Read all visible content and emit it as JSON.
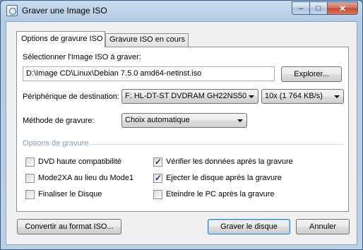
{
  "window": {
    "title": "Graver une Image ISO",
    "caption": {
      "minimize": "–",
      "maximize": "□",
      "close": "✕"
    }
  },
  "tabs": [
    {
      "label": "Options de gravure ISO",
      "active": true
    },
    {
      "label": "Gravure ISO en cours",
      "active": false
    }
  ],
  "iso": {
    "label": "Sélectionner l'Image ISO à graver:",
    "path": "D:\\Image CD\\Linux\\Debian 7.5.0 amd64-netinst.iso",
    "browse_label": "Explorer..."
  },
  "device": {
    "label": "Périphérique de destination:",
    "drive": "F: HL-DT-ST DVDRAM GH22NS50",
    "speed": "10x (1 764 KB/s)"
  },
  "method": {
    "label": "Méthode de gravure:",
    "value": "Choix automatique"
  },
  "options": {
    "heading": "Options de gravure",
    "items": [
      {
        "label": "DVD haute compatibilité",
        "checked": false
      },
      {
        "label": "Mode2XA au lieu du Mode1",
        "checked": false
      },
      {
        "label": "Finaliser le Disque",
        "checked": false
      },
      {
        "label": "Vérifier les données après la gravure",
        "checked": true
      },
      {
        "label": "Ejecter le disque après la gravure",
        "checked": true
      },
      {
        "label": "Eteindre le PC après la gravure",
        "checked": false
      }
    ]
  },
  "footer": {
    "convert_label": "Convertir au format ISO...",
    "burn_label": "Graver le disque",
    "cancel_label": "Annuler"
  },
  "colors": {
    "section_heading": "#8a9db5",
    "default_button_border": "#3c7fb1",
    "checkmark": "#1b3b6f"
  },
  "icons": {
    "app": "disc-icon",
    "checkmark": "✓"
  }
}
